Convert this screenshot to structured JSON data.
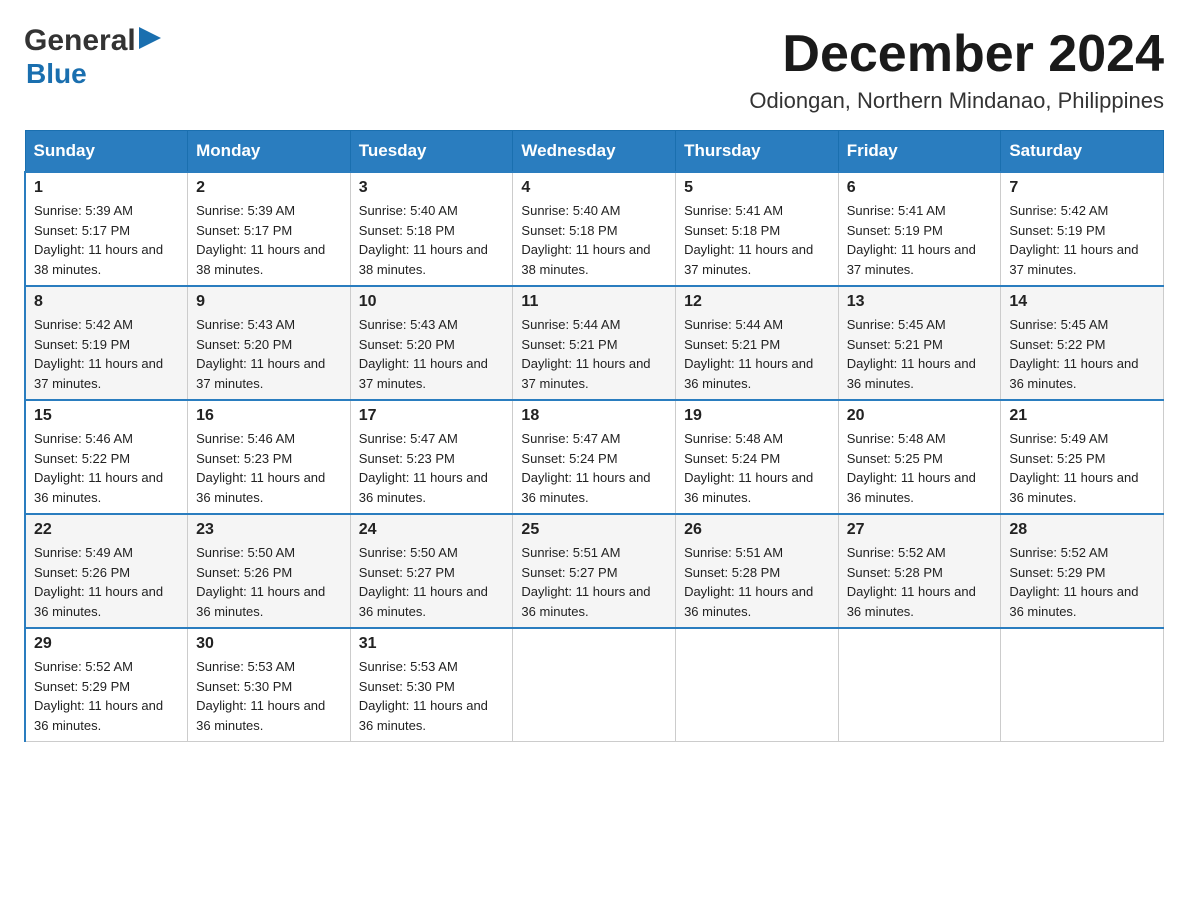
{
  "header": {
    "logo_general": "General",
    "logo_blue": "Blue",
    "month_year": "December 2024",
    "location": "Odiongan, Northern Mindanao, Philippines"
  },
  "days_of_week": [
    "Sunday",
    "Monday",
    "Tuesday",
    "Wednesday",
    "Thursday",
    "Friday",
    "Saturday"
  ],
  "weeks": [
    [
      {
        "day": "1",
        "sunrise": "5:39 AM",
        "sunset": "5:17 PM",
        "daylight": "11 hours and 38 minutes."
      },
      {
        "day": "2",
        "sunrise": "5:39 AM",
        "sunset": "5:17 PM",
        "daylight": "11 hours and 38 minutes."
      },
      {
        "day": "3",
        "sunrise": "5:40 AM",
        "sunset": "5:18 PM",
        "daylight": "11 hours and 38 minutes."
      },
      {
        "day": "4",
        "sunrise": "5:40 AM",
        "sunset": "5:18 PM",
        "daylight": "11 hours and 38 minutes."
      },
      {
        "day": "5",
        "sunrise": "5:41 AM",
        "sunset": "5:18 PM",
        "daylight": "11 hours and 37 minutes."
      },
      {
        "day": "6",
        "sunrise": "5:41 AM",
        "sunset": "5:19 PM",
        "daylight": "11 hours and 37 minutes."
      },
      {
        "day": "7",
        "sunrise": "5:42 AM",
        "sunset": "5:19 PM",
        "daylight": "11 hours and 37 minutes."
      }
    ],
    [
      {
        "day": "8",
        "sunrise": "5:42 AM",
        "sunset": "5:19 PM",
        "daylight": "11 hours and 37 minutes."
      },
      {
        "day": "9",
        "sunrise": "5:43 AM",
        "sunset": "5:20 PM",
        "daylight": "11 hours and 37 minutes."
      },
      {
        "day": "10",
        "sunrise": "5:43 AM",
        "sunset": "5:20 PM",
        "daylight": "11 hours and 37 minutes."
      },
      {
        "day": "11",
        "sunrise": "5:44 AM",
        "sunset": "5:21 PM",
        "daylight": "11 hours and 37 minutes."
      },
      {
        "day": "12",
        "sunrise": "5:44 AM",
        "sunset": "5:21 PM",
        "daylight": "11 hours and 36 minutes."
      },
      {
        "day": "13",
        "sunrise": "5:45 AM",
        "sunset": "5:21 PM",
        "daylight": "11 hours and 36 minutes."
      },
      {
        "day": "14",
        "sunrise": "5:45 AM",
        "sunset": "5:22 PM",
        "daylight": "11 hours and 36 minutes."
      }
    ],
    [
      {
        "day": "15",
        "sunrise": "5:46 AM",
        "sunset": "5:22 PM",
        "daylight": "11 hours and 36 minutes."
      },
      {
        "day": "16",
        "sunrise": "5:46 AM",
        "sunset": "5:23 PM",
        "daylight": "11 hours and 36 minutes."
      },
      {
        "day": "17",
        "sunrise": "5:47 AM",
        "sunset": "5:23 PM",
        "daylight": "11 hours and 36 minutes."
      },
      {
        "day": "18",
        "sunrise": "5:47 AM",
        "sunset": "5:24 PM",
        "daylight": "11 hours and 36 minutes."
      },
      {
        "day": "19",
        "sunrise": "5:48 AM",
        "sunset": "5:24 PM",
        "daylight": "11 hours and 36 minutes."
      },
      {
        "day": "20",
        "sunrise": "5:48 AM",
        "sunset": "5:25 PM",
        "daylight": "11 hours and 36 minutes."
      },
      {
        "day": "21",
        "sunrise": "5:49 AM",
        "sunset": "5:25 PM",
        "daylight": "11 hours and 36 minutes."
      }
    ],
    [
      {
        "day": "22",
        "sunrise": "5:49 AM",
        "sunset": "5:26 PM",
        "daylight": "11 hours and 36 minutes."
      },
      {
        "day": "23",
        "sunrise": "5:50 AM",
        "sunset": "5:26 PM",
        "daylight": "11 hours and 36 minutes."
      },
      {
        "day": "24",
        "sunrise": "5:50 AM",
        "sunset": "5:27 PM",
        "daylight": "11 hours and 36 minutes."
      },
      {
        "day": "25",
        "sunrise": "5:51 AM",
        "sunset": "5:27 PM",
        "daylight": "11 hours and 36 minutes."
      },
      {
        "day": "26",
        "sunrise": "5:51 AM",
        "sunset": "5:28 PM",
        "daylight": "11 hours and 36 minutes."
      },
      {
        "day": "27",
        "sunrise": "5:52 AM",
        "sunset": "5:28 PM",
        "daylight": "11 hours and 36 minutes."
      },
      {
        "day": "28",
        "sunrise": "5:52 AM",
        "sunset": "5:29 PM",
        "daylight": "11 hours and 36 minutes."
      }
    ],
    [
      {
        "day": "29",
        "sunrise": "5:52 AM",
        "sunset": "5:29 PM",
        "daylight": "11 hours and 36 minutes."
      },
      {
        "day": "30",
        "sunrise": "5:53 AM",
        "sunset": "5:30 PM",
        "daylight": "11 hours and 36 minutes."
      },
      {
        "day": "31",
        "sunrise": "5:53 AM",
        "sunset": "5:30 PM",
        "daylight": "11 hours and 36 minutes."
      },
      null,
      null,
      null,
      null
    ]
  ]
}
